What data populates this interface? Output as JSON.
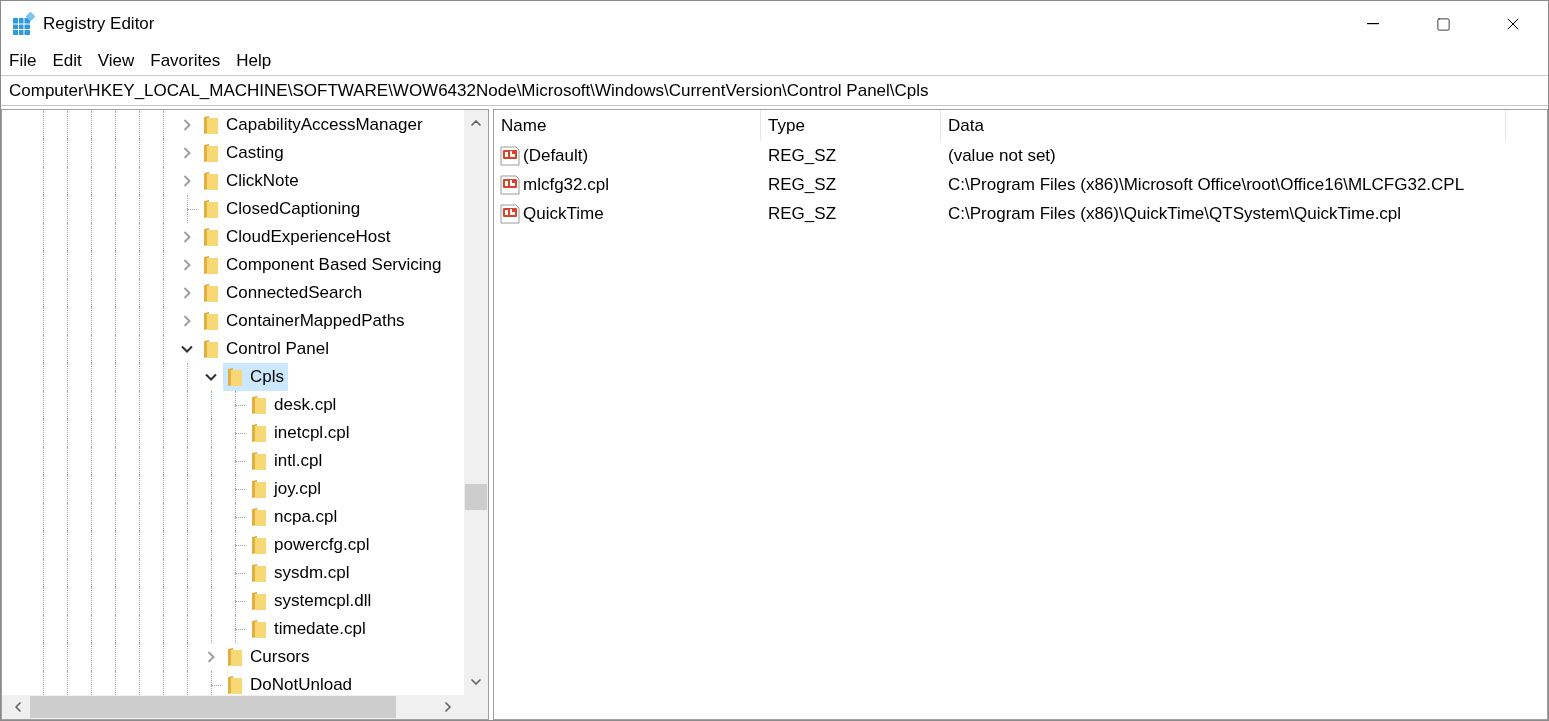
{
  "window": {
    "title": "Registry Editor"
  },
  "menu": [
    "File",
    "Edit",
    "View",
    "Favorites",
    "Help"
  ],
  "address": "Computer\\HKEY_LOCAL_MACHINE\\SOFTWARE\\WOW6432Node\\Microsoft\\Windows\\CurrentVersion\\Control Panel\\Cpls",
  "tree": [
    {
      "label": "CapabilityAccessManager",
      "kind": "branch",
      "expanded": false,
      "selected": false
    },
    {
      "label": "Casting",
      "kind": "branch",
      "expanded": false,
      "selected": false
    },
    {
      "label": "ClickNote",
      "kind": "branch",
      "expanded": false,
      "selected": false
    },
    {
      "label": "ClosedCaptioning",
      "kind": "leaf",
      "selected": false
    },
    {
      "label": "CloudExperienceHost",
      "kind": "branch",
      "expanded": false,
      "selected": false
    },
    {
      "label": "Component Based Servicing",
      "kind": "branch",
      "expanded": false,
      "selected": false
    },
    {
      "label": "ConnectedSearch",
      "kind": "branch",
      "expanded": false,
      "selected": false
    },
    {
      "label": "ContainerMappedPaths",
      "kind": "branch",
      "expanded": false,
      "selected": false
    },
    {
      "label": "Control Panel",
      "kind": "branch",
      "expanded": true,
      "selected": false,
      "children": [
        {
          "label": "Cpls",
          "kind": "branch",
          "expanded": true,
          "selected": true,
          "children": [
            {
              "label": "desk.cpl",
              "kind": "leaf",
              "selected": false
            },
            {
              "label": "inetcpl.cpl",
              "kind": "leaf",
              "selected": false
            },
            {
              "label": "intl.cpl",
              "kind": "leaf",
              "selected": false
            },
            {
              "label": "joy.cpl",
              "kind": "leaf",
              "selected": false
            },
            {
              "label": "ncpa.cpl",
              "kind": "leaf",
              "selected": false
            },
            {
              "label": "powercfg.cpl",
              "kind": "leaf",
              "selected": false
            },
            {
              "label": "sysdm.cpl",
              "kind": "leaf",
              "selected": false
            },
            {
              "label": "systemcpl.dll",
              "kind": "leaf",
              "selected": false
            },
            {
              "label": "timedate.cpl",
              "kind": "leaf",
              "selected": false
            }
          ]
        },
        {
          "label": "Cursors",
          "kind": "branch",
          "expanded": false,
          "selected": false
        },
        {
          "label": "DoNotUnload",
          "kind": "leaf",
          "selected": false
        }
      ]
    }
  ],
  "table": {
    "columns": [
      "Name",
      "Type",
      "Data"
    ],
    "rows": [
      {
        "name": "(Default)",
        "type": "REG_SZ",
        "data": "(value not set)"
      },
      {
        "name": "mlcfg32.cpl",
        "type": "REG_SZ",
        "data": "C:\\Program Files (x86)\\Microsoft Office\\root\\Office16\\MLCFG32.CPL"
      },
      {
        "name": "QuickTime",
        "type": "REG_SZ",
        "data": "C:\\Program Files (x86)\\QuickTime\\QTSystem\\QuickTime.cpl"
      }
    ]
  }
}
